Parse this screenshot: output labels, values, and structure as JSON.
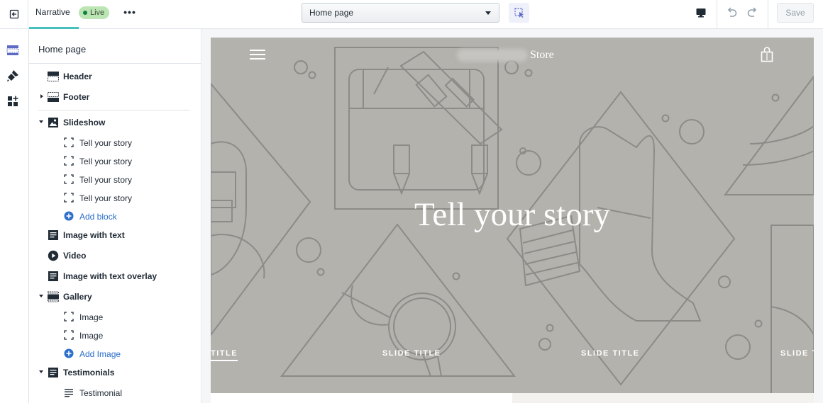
{
  "topbar": {
    "theme_name": "Narrative",
    "live_label": "Live",
    "more_label": "•••",
    "page_select_value": "Home page",
    "save_label": "Save"
  },
  "sidebar": {
    "title": "Home page",
    "sections": [
      {
        "label": "Header",
        "icon": "header-section-icon"
      },
      {
        "label": "Footer",
        "icon": "footer-section-icon"
      },
      {
        "label": "Slideshow",
        "icon": "image-icon"
      },
      {
        "label": "Image with text",
        "icon": "text-block-icon"
      },
      {
        "label": "Video",
        "icon": "play-icon"
      },
      {
        "label": "Image with text overlay",
        "icon": "text-block-icon"
      },
      {
        "label": "Gallery",
        "icon": "gallery-icon"
      },
      {
        "label": "Testimonials",
        "icon": "text-block-icon"
      }
    ],
    "slideshow_blocks": [
      "Tell your story",
      "Tell your story",
      "Tell your story",
      "Tell your story"
    ],
    "add_block_label": "Add block",
    "gallery_blocks": [
      "Image",
      "Image"
    ],
    "add_image_label": "Add Image",
    "testimonial_blocks": [
      "Testimonial"
    ]
  },
  "preview": {
    "store_name": "Store",
    "hero_title": "Tell your story",
    "slide_tabs": [
      "TITLE",
      "SLIDE TITLE",
      "SLIDE TITLE",
      "SLIDE T"
    ]
  },
  "colors": {
    "accent": "#47c1bf",
    "live_badge": "#bbe5b3",
    "link": "#2c6ecb",
    "hero_bg": "#b3b2ad",
    "line_art": "#8c8b87"
  }
}
